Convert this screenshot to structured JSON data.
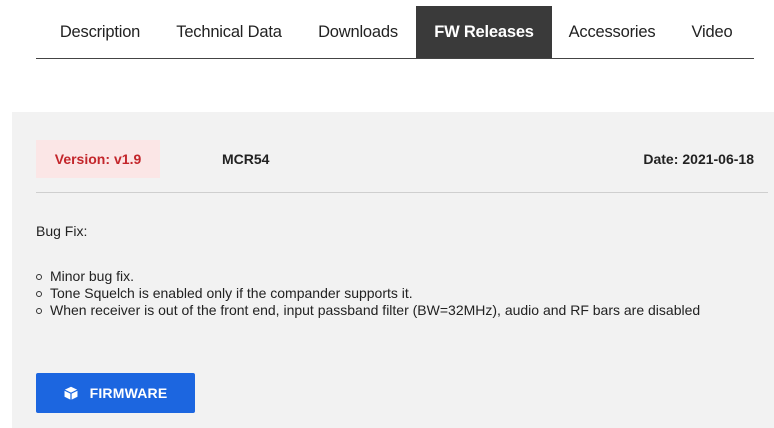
{
  "tabs": [
    {
      "label": "Description",
      "active": false
    },
    {
      "label": "Technical Data",
      "active": false
    },
    {
      "label": "Downloads",
      "active": false
    },
    {
      "label": "FW Releases",
      "active": true
    },
    {
      "label": "Accessories",
      "active": false
    },
    {
      "label": "Video",
      "active": false
    }
  ],
  "release": {
    "version_label": "Version:",
    "version_value": "v1.9",
    "model": "MCR54",
    "date_label": "Date:",
    "date_value": "2021-06-18",
    "section_label": "Bug Fix:",
    "notes": [
      "Minor bug fix.",
      "Tone Squelch is enabled only if the compander supports it.",
      "When receiver is out of the front end, input passband filter (BW=32MHz), audio and RF bars are disabled"
    ],
    "button_label": "FIRMWARE",
    "button_icon": "cube-icon"
  },
  "colors": {
    "accent": "#1c66e0",
    "version_text": "#c3262b",
    "version_bg": "#fbe6e6",
    "active_tab_bg": "#3a3a3a",
    "panel_bg": "#f2f2f2"
  }
}
